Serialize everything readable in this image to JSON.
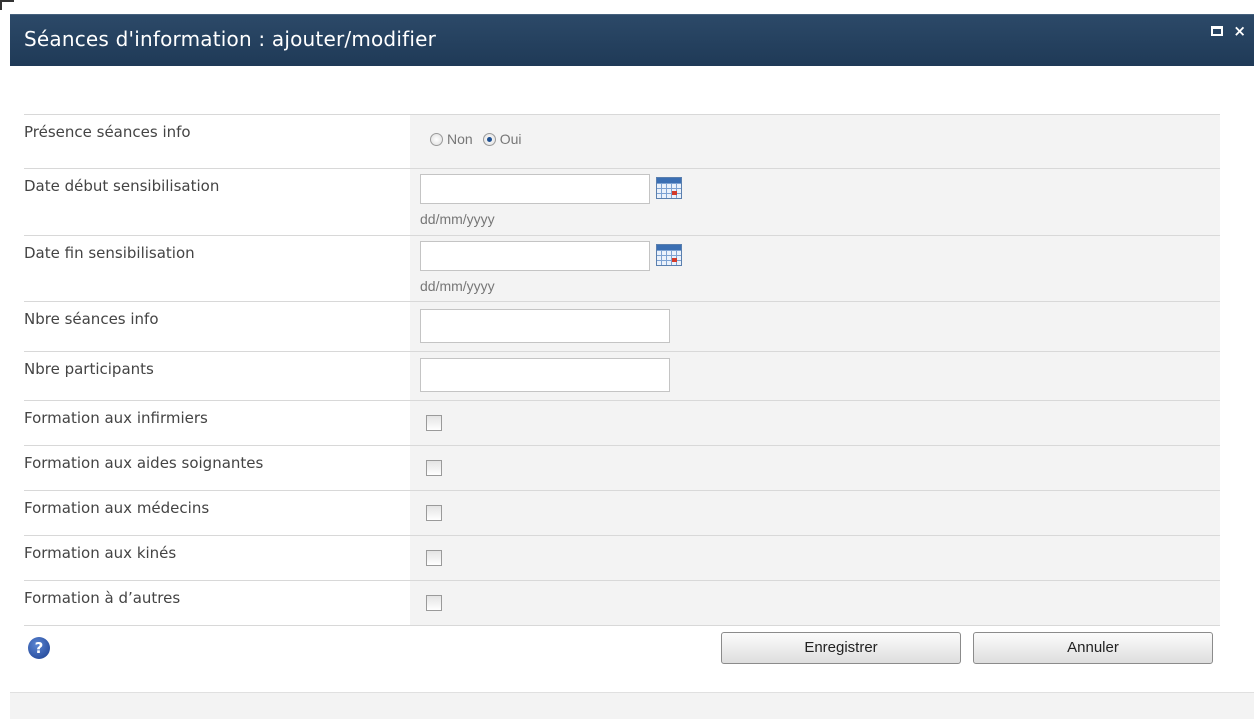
{
  "dialog": {
    "title": "Séances d'information : ajouter/modifier",
    "controls": {
      "maximize": "maximize-icon",
      "close_label": "×"
    }
  },
  "form": {
    "rows": [
      {
        "label": "Présence séances info",
        "type": "radio",
        "options": [
          "Non",
          "Oui"
        ],
        "selected": "Oui"
      },
      {
        "label": "Date début sensibilisation",
        "type": "date",
        "value": "",
        "hint": "dd/mm/yyyy"
      },
      {
        "label": "Date fin sensibilisation",
        "type": "date",
        "value": "",
        "hint": "dd/mm/yyyy"
      },
      {
        "label": "Nbre séances info",
        "type": "text",
        "value": ""
      },
      {
        "label": "Nbre participants",
        "type": "text",
        "value": ""
      },
      {
        "label": "Formation aux infirmiers",
        "type": "checkbox",
        "checked": false
      },
      {
        "label": "Formation aux aides soignantes",
        "type": "checkbox",
        "checked": false
      },
      {
        "label": "Formation aux médecins",
        "type": "checkbox",
        "checked": false
      },
      {
        "label": "Formation aux kinés",
        "type": "checkbox",
        "checked": false
      },
      {
        "label": "Formation à d’autres",
        "type": "checkbox",
        "checked": false
      }
    ]
  },
  "actions": {
    "help_label": "?",
    "save_label": "Enregistrer",
    "cancel_label": "Annuler"
  },
  "colors": {
    "titlebar": "#243f5e",
    "value_cell": "#f3f3f3",
    "radio_selected": "#1d4f91"
  }
}
